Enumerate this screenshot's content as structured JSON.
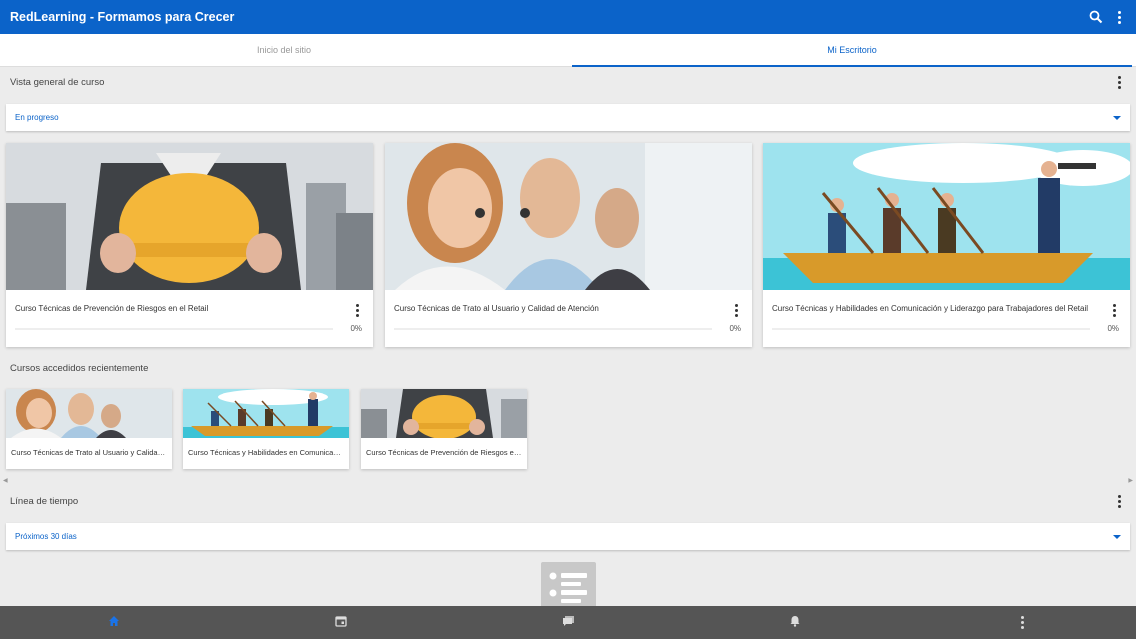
{
  "app": {
    "title": "RedLearning - Formamos para Crecer",
    "icons": [
      "search-icon",
      "more-vertical-icon"
    ]
  },
  "tabs": [
    {
      "label": "Inicio del sitio",
      "active": false
    },
    {
      "label": "Mi Escritorio",
      "active": true
    }
  ],
  "overview": {
    "title": "Vista general de curso",
    "filter_value": "En progreso"
  },
  "courses": [
    {
      "name": "Curso Técnicas de Prevención de Riesgos en el Retail",
      "progress": "0%",
      "image": "hard-hat"
    },
    {
      "name": "Curso Técnicas de Trato al Usuario y Calidad de Atención",
      "progress": "0%",
      "image": "call-center"
    },
    {
      "name": "Curso Técnicas y Habilidades en Comunicación y Liderazgo para Trabajadores del Retail",
      "progress": "0%",
      "image": "rowing-team"
    }
  ],
  "recent": {
    "title": "Cursos accedidos recientemente",
    "items": [
      {
        "name": "Curso Técnicas de Trato al Usuario y Calidad de Atención",
        "image": "call-center"
      },
      {
        "name": "Curso Técnicas y Habilidades en Comunicación y Liderazgo para Trabajadores del Retail",
        "image": "rowing-team"
      },
      {
        "name": "Curso Técnicas de Prevención de Riesgos en el Retail",
        "image": "hard-hat"
      }
    ]
  },
  "timeline": {
    "title": "Línea de tiempo",
    "filter_value": "Próximos 30 días"
  },
  "bottom_nav": [
    {
      "icon": "home-icon",
      "active": true
    },
    {
      "icon": "calendar-icon",
      "active": false
    },
    {
      "icon": "messages-icon",
      "active": false
    },
    {
      "icon": "bell-icon",
      "active": false
    },
    {
      "icon": "more-vertical-icon",
      "active": false
    }
  ],
  "colors": {
    "primary": "#0b63c9",
    "background": "#ececec",
    "bottom_nav": "#555555"
  }
}
